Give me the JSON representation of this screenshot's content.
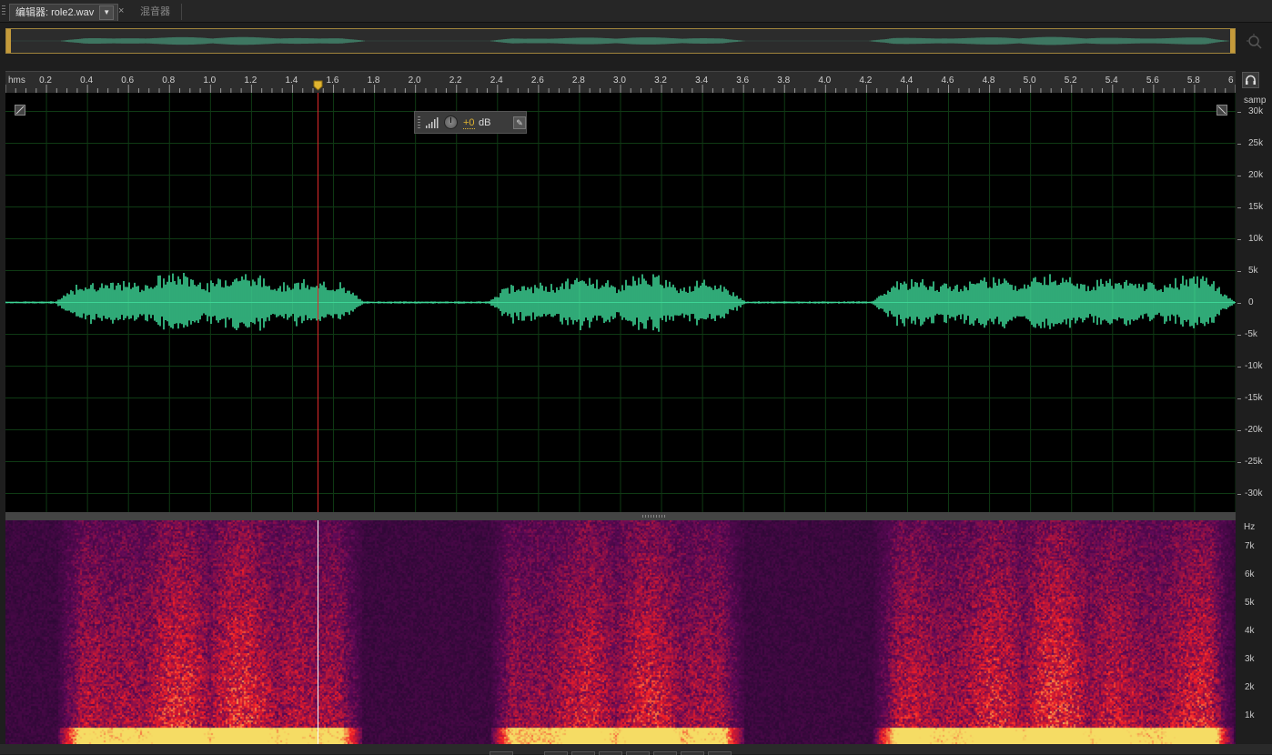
{
  "tabs": {
    "editor_label": "编辑器: role2.wav",
    "menu_glyph": "▼",
    "close_glyph": "×",
    "mixer_label": "混音器"
  },
  "ruler": {
    "unit": "hms",
    "ticks": [
      "0.2",
      "0.4",
      "0.6",
      "0.8",
      "1.0",
      "1.2",
      "1.4",
      "1.6",
      "1.8",
      "2.0",
      "2.2",
      "2.4",
      "2.6",
      "2.8",
      "3.0",
      "3.2",
      "3.4",
      "3.6",
      "3.8",
      "4.0",
      "4.2",
      "4.4",
      "4.6",
      "4.8",
      "5.0",
      "5.2",
      "5.4",
      "5.6",
      "5.8",
      "6"
    ]
  },
  "amplitude_axis": {
    "unit": "samp",
    "labels": [
      "30k",
      "25k",
      "20k",
      "15k",
      "10k",
      "5k",
      "0",
      "-5k",
      "-10k",
      "-15k",
      "-20k",
      "-25k",
      "-30k"
    ]
  },
  "frequency_axis": {
    "unit": "Hz",
    "labels": [
      "7k",
      "6k",
      "5k",
      "4k",
      "3k",
      "2k",
      "1k"
    ]
  },
  "hud": {
    "value": "+0",
    "unit": "dB"
  },
  "playhead_time_seconds": 1.52,
  "duration_seconds": 6.0,
  "colors": {
    "waveform": "#3dd495",
    "playhead": "#e02a2a",
    "grid": "#0f3a14",
    "hud_value": "#e0b430",
    "overview_border": "#c49a3a"
  },
  "icons": {
    "headphone": "headphone-icon",
    "zoom": "zoom-icon",
    "pin": "pin-icon",
    "level": "level-meter-icon",
    "knob": "volume-knob-icon"
  }
}
